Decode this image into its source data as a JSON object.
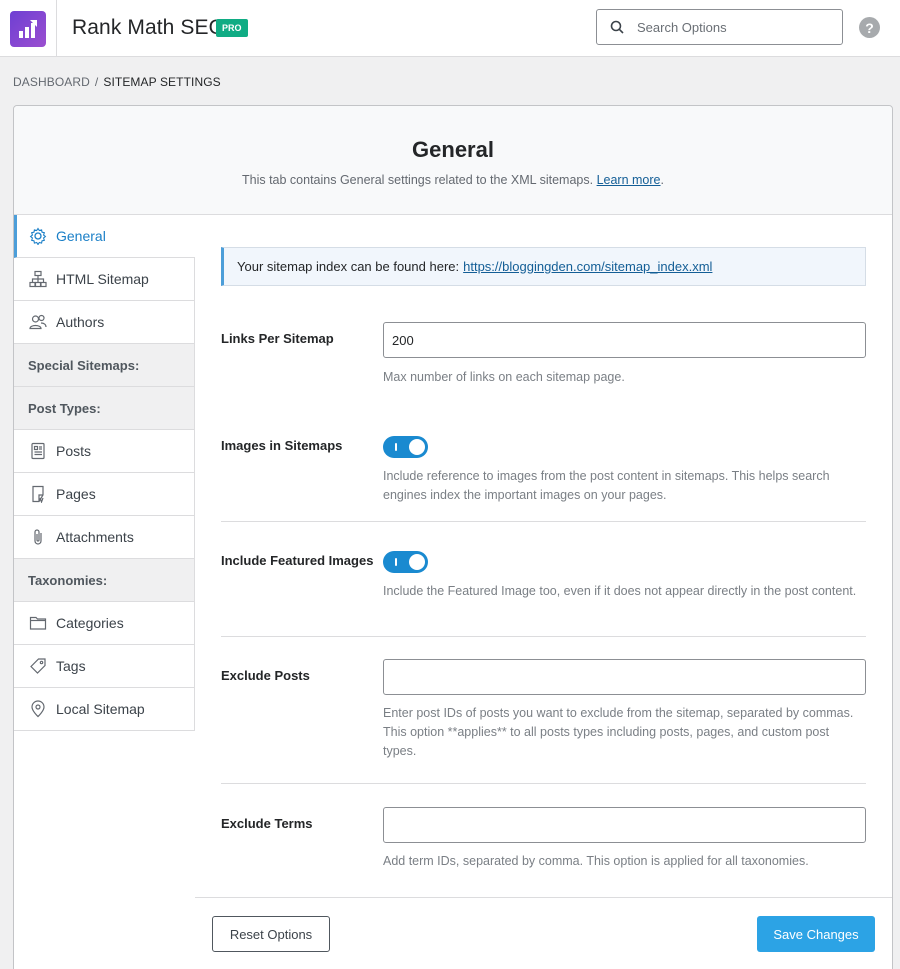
{
  "header": {
    "app_title": "Rank Math SEO",
    "badge": "PRO",
    "search_placeholder": "Search Options",
    "help_label": "?"
  },
  "breadcrumb": {
    "root": "DASHBOARD",
    "separator": "/",
    "current": "SITEMAP SETTINGS"
  },
  "panel": {
    "title": "General",
    "subtitle": "This tab contains General settings related to the XML sitemaps.",
    "learn_more": "Learn more",
    "period": "."
  },
  "sidebar": {
    "items": [
      {
        "label": "General",
        "icon": "gear-icon",
        "active": true
      },
      {
        "label": "HTML Sitemap",
        "icon": "sitemap-icon"
      },
      {
        "label": "Authors",
        "icon": "users-icon"
      },
      {
        "heading": "Special Sitemaps:"
      },
      {
        "heading": "Post Types:"
      },
      {
        "label": "Posts",
        "icon": "post-icon"
      },
      {
        "label": "Pages",
        "icon": "page-icon"
      },
      {
        "label": "Attachments",
        "icon": "paperclip-icon"
      },
      {
        "heading": "Taxonomies:"
      },
      {
        "label": "Categories",
        "icon": "folder-icon"
      },
      {
        "label": "Tags",
        "icon": "tag-icon"
      },
      {
        "label": "Local Sitemap",
        "icon": "location-pin-icon"
      }
    ]
  },
  "notice": {
    "text": "Your sitemap index can be found here:",
    "link": "https://bloggingden.com/sitemap_index.xml"
  },
  "fields": {
    "links_per_sitemap": {
      "label": "Links Per Sitemap",
      "value": "200",
      "description": "Max number of links on each sitemap page."
    },
    "images_in_sitemaps": {
      "label": "Images in Sitemaps",
      "enabled": true,
      "description": "Include reference to images from the post content in sitemaps. This helps search engines index the important images on your pages."
    },
    "include_featured_images": {
      "label": "Include Featured Images",
      "enabled": true,
      "description": "Include the Featured Image too, even if it does not appear directly in the post content."
    },
    "exclude_posts": {
      "label": "Exclude Posts",
      "value": "",
      "description": "Enter post IDs of posts you want to exclude from the sitemap, separated by commas. This option **applies** to all posts types including posts, pages, and custom post types."
    },
    "exclude_terms": {
      "label": "Exclude Terms",
      "value": "",
      "description": "Add term IDs, separated by comma. This option is applied for all taxonomies."
    }
  },
  "footer": {
    "reset_label": "Reset Options",
    "save_label": "Save Changes"
  },
  "colors": {
    "accent": "#2ca3e5",
    "toggle_on": "#1a8ad0",
    "pro_badge": "#10ac84",
    "logo": "#7b45d1"
  }
}
